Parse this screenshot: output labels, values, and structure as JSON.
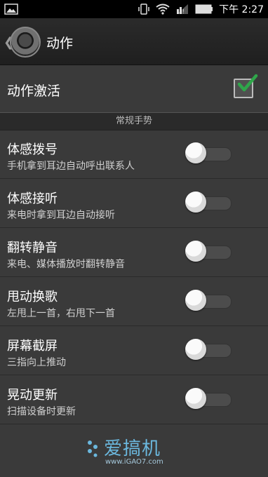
{
  "status_bar": {
    "time": "下午 2:27",
    "icons": [
      "image-icon",
      "vibrate-icon",
      "wifi-icon",
      "signal-icon",
      "battery-icon"
    ]
  },
  "action_bar": {
    "title": "动作",
    "icon": "settings-gear-icon"
  },
  "main_toggle": {
    "label": "动作激活",
    "checked": true,
    "check_color": "#2fa64a"
  },
  "section": {
    "header": "常规手势"
  },
  "items": [
    {
      "title": "体感拨号",
      "subtitle": "手机拿到耳边自动呼出联系人",
      "enabled": false
    },
    {
      "title": "体感接听",
      "subtitle": "来电时拿到耳边自动接听",
      "enabled": false
    },
    {
      "title": "翻转静音",
      "subtitle": "来电、媒体播放时翻转静音",
      "enabled": false
    },
    {
      "title": "甩动换歌",
      "subtitle": "左甩上一首，右甩下一首",
      "enabled": false
    },
    {
      "title": "屏幕截屏",
      "subtitle": "三指向上推动",
      "enabled": false
    },
    {
      "title": "晃动更新",
      "subtitle": "扫描设备时更新",
      "enabled": false
    }
  ],
  "watermark": {
    "text": "爱搞机",
    "url": "www.iGAO7.com"
  }
}
